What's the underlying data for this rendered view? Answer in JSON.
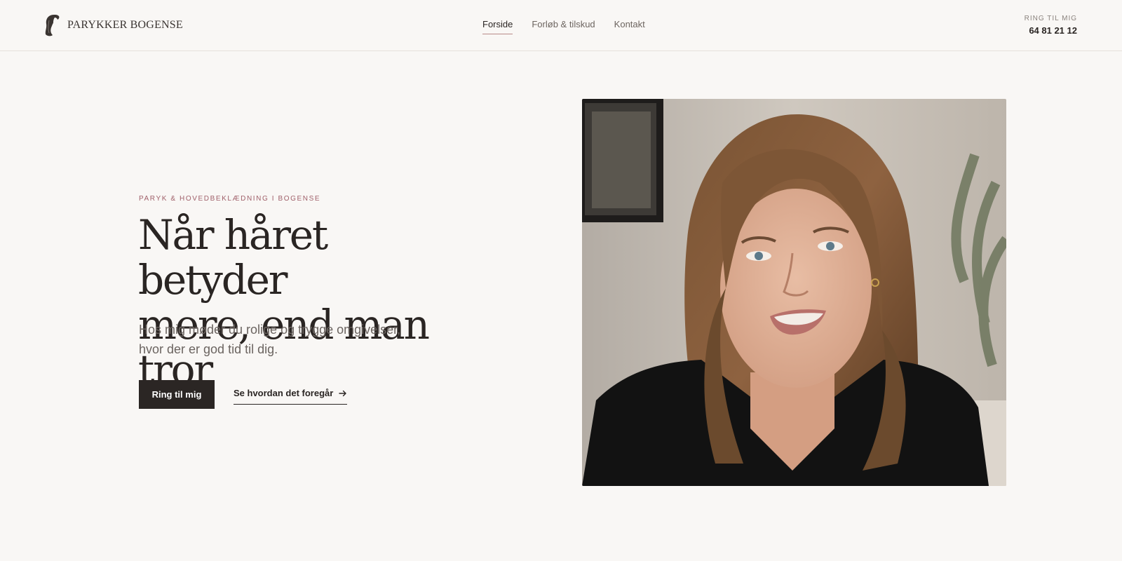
{
  "brand": {
    "name": "PARYKKER BOGENSE",
    "logo_icon": "woman-profile-icon"
  },
  "nav": {
    "items": [
      {
        "label": "Forside",
        "active": true
      },
      {
        "label": "Forløb & tilskud",
        "active": false
      },
      {
        "label": "Kontakt",
        "active": false
      }
    ]
  },
  "header_call": {
    "label": "RING TIL MIG",
    "phone": "64 81 21 12"
  },
  "hero": {
    "eyebrow": "PARYK & HOVEDBEKLÆDNING I BOGENSE",
    "headline_line1": "Når håret betyder",
    "headline_line2": "mere, end man tror",
    "lead_line1": "Hos mig møder du rolige og trygge omgivelser,",
    "lead_line2": "hvor der er god tid til dig.",
    "primary_button": "Ring til mig",
    "secondary_link": "Se hvordan det foregår",
    "secondary_icon": "arrow-right-icon"
  },
  "colors": {
    "background": "#f9f7f5",
    "text": "#2a2523",
    "accent": "#a0606a",
    "button": "#2b2624"
  }
}
